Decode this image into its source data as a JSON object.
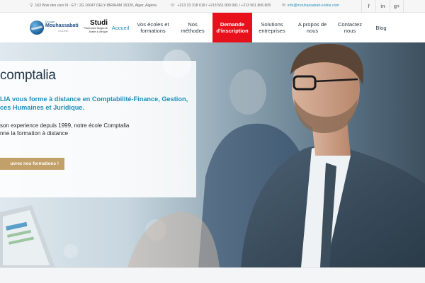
{
  "topbar": {
    "address": "163 Bois des cars III - ET : 2G 16047 DELY-IBRAHIM 16320, Alger, Algérie.",
    "phones": "+213 23 318 618 / +213 561 800 991 / +213 561 806 805",
    "email": "info@mouhassabati-online.com",
    "socials": [
      "f",
      "in",
      "g+"
    ]
  },
  "logo": {
    "small": "Groupe",
    "name": "Mouhassabati",
    "online": "ONLINE"
  },
  "partner": {
    "brand": "Studi",
    "tag_line1": "Partenaire Maghreb",
    "tag_line2": "Arabe & Afrique"
  },
  "nav": {
    "home": "Accueil",
    "schools_l1": "Vos écoles et",
    "schools_l2": "formations",
    "methods_l1": "Nos",
    "methods_l2": "méthodes",
    "signup_l1": "Demande",
    "signup_l2": "d'inscription",
    "solutions_l1": "Solutions",
    "solutions_l2": "entreprises",
    "about_l1": "A propos de",
    "about_l2": "nous",
    "contact_l1": "Contactez",
    "contact_l2": "nous",
    "blog": "Blog"
  },
  "hero": {
    "title": "comptalia",
    "lead_l1": "LIA vous forme à distance en Comptabilité-Finance, Gestion,",
    "lead_l2": "ces Humaines et Juridique.",
    "body_l1": "son experience depuis 1999, notre école Comptalia",
    "body_l2": "nne la formation à distance",
    "button": "uvrez nos formations !"
  },
  "colors": {
    "accent": "#1e8fb8",
    "cta": "#e8101a",
    "button": "#c2a06a",
    "brand_dark": "#1c4f86"
  }
}
